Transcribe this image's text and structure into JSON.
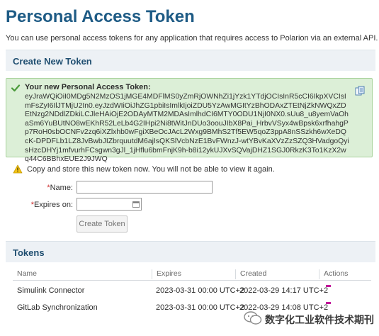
{
  "page": {
    "title": "Personal Access Token",
    "intro": "You can use personal access tokens for any application that requires access to Polarion via an external API."
  },
  "create_section": {
    "title": "Create New Token",
    "token_label": "Your new Personal Access Token:",
    "token_value": "eyJraWQiOiI0MDg5N2MzOS1jMGE4MDFlMS0yZmRjOWNhZi1jYzk1YTdjOCIsInR5cCI6IkpXVCIsImFsZyI6IlJTMjU2In0.eyJzdWIiOiJhZG1pbiIsImlkIjoiZDU5YzAwMGItYzBhODAxZTEtNjZkNWQxZDEtNzg2NDdlZDkiLCJleHAiOjE2ODAyMTM2MDAsImlhdCI6MTY0ODU1NjI0NX0.sUu8_u8yemVaOhaSm6YuBUtNO8wEKhR52LeLb4G2IHpi2Ni8tWitJnDUo3oouJIbX8Pai_HrbvVSyx4wBpsk6xrfhahgPp7RoH0sbOCNFv2zq6iXZlxhb0wFgiXBeOcJAcL2Wxg9BMhS2Tf5EW5qoZ3ppA8nSSzkh6wXeDQcK-DPDFLb1LZ8JvBwbJIZbrquutdM6ajIsQKSlVcbNzE1BvFWnzJ-wtYBvKaXVzZzSZQ3HVadgoQyisHzcDHYj1mfvurhFCsgwn3gJl_1jHflu6bmFnjK9h-b8i12ykUJXvSQVajDHZ1SGJ0RkzK3To1KzX2wq44C6BBhxEUE2J9JWQ",
    "copy_icon": "copy-icon",
    "warning": "Copy and store this new token now. You will not be able to view it again.",
    "name_label": "Name:",
    "name_value": "",
    "expires_label": "Expires on:",
    "expires_value": "",
    "required_mark": "*",
    "create_button": "Create Token"
  },
  "tokens_section": {
    "title": "Tokens",
    "columns": [
      "Name",
      "Expires",
      "Created",
      "Actions"
    ],
    "rows": [
      {
        "name": "Simulink Connector",
        "expires": "2023-03-31 00:00 UTC+2",
        "created": "2022-03-29 14:17 UTC+2"
      },
      {
        "name": "GitLab Synchronization",
        "expires": "2023-03-31 00:00 UTC+2",
        "created": "2022-03-29 14:08 UTC+2"
      }
    ]
  },
  "watermark": {
    "text": "数字化工业软件技术期刊"
  },
  "colors": {
    "title": "#1e5b85",
    "section_bar": "#edf1f5",
    "token_box_bg": "#dcefd7",
    "token_box_border": "#a9d39c",
    "action_icon": "#c2169a",
    "required": "#cc2a2a"
  }
}
